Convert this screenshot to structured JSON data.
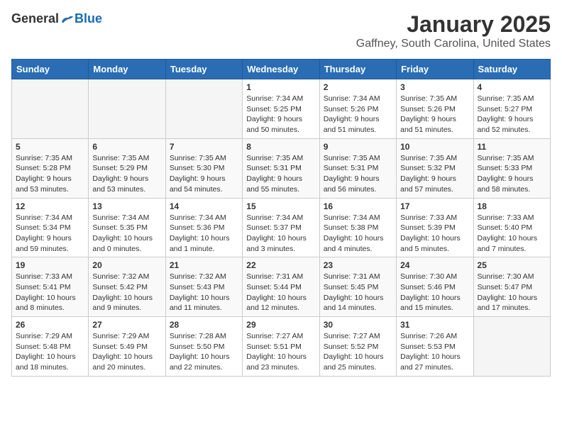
{
  "header": {
    "logo": {
      "general": "General",
      "blue": "Blue"
    },
    "title": "January 2025",
    "location": "Gaffney, South Carolina, United States"
  },
  "days_of_week": [
    "Sunday",
    "Monday",
    "Tuesday",
    "Wednesday",
    "Thursday",
    "Friday",
    "Saturday"
  ],
  "weeks": [
    {
      "cells": [
        {
          "day": null,
          "empty": true
        },
        {
          "day": null,
          "empty": true
        },
        {
          "day": null,
          "empty": true
        },
        {
          "day": "1",
          "sunrise": "7:34 AM",
          "sunset": "5:25 PM",
          "daylight": "9 hours and 50 minutes."
        },
        {
          "day": "2",
          "sunrise": "7:34 AM",
          "sunset": "5:26 PM",
          "daylight": "9 hours and 51 minutes."
        },
        {
          "day": "3",
          "sunrise": "7:35 AM",
          "sunset": "5:26 PM",
          "daylight": "9 hours and 51 minutes."
        },
        {
          "day": "4",
          "sunrise": "7:35 AM",
          "sunset": "5:27 PM",
          "daylight": "9 hours and 52 minutes."
        }
      ]
    },
    {
      "cells": [
        {
          "day": "5",
          "sunrise": "7:35 AM",
          "sunset": "5:28 PM",
          "daylight": "9 hours and 53 minutes."
        },
        {
          "day": "6",
          "sunrise": "7:35 AM",
          "sunset": "5:29 PM",
          "daylight": "9 hours and 53 minutes."
        },
        {
          "day": "7",
          "sunrise": "7:35 AM",
          "sunset": "5:30 PM",
          "daylight": "9 hours and 54 minutes."
        },
        {
          "day": "8",
          "sunrise": "7:35 AM",
          "sunset": "5:31 PM",
          "daylight": "9 hours and 55 minutes."
        },
        {
          "day": "9",
          "sunrise": "7:35 AM",
          "sunset": "5:31 PM",
          "daylight": "9 hours and 56 minutes."
        },
        {
          "day": "10",
          "sunrise": "7:35 AM",
          "sunset": "5:32 PM",
          "daylight": "9 hours and 57 minutes."
        },
        {
          "day": "11",
          "sunrise": "7:35 AM",
          "sunset": "5:33 PM",
          "daylight": "9 hours and 58 minutes."
        }
      ]
    },
    {
      "cells": [
        {
          "day": "12",
          "sunrise": "7:34 AM",
          "sunset": "5:34 PM",
          "daylight": "9 hours and 59 minutes."
        },
        {
          "day": "13",
          "sunrise": "7:34 AM",
          "sunset": "5:35 PM",
          "daylight": "10 hours and 0 minutes."
        },
        {
          "day": "14",
          "sunrise": "7:34 AM",
          "sunset": "5:36 PM",
          "daylight": "10 hours and 1 minute."
        },
        {
          "day": "15",
          "sunrise": "7:34 AM",
          "sunset": "5:37 PM",
          "daylight": "10 hours and 3 minutes."
        },
        {
          "day": "16",
          "sunrise": "7:34 AM",
          "sunset": "5:38 PM",
          "daylight": "10 hours and 4 minutes."
        },
        {
          "day": "17",
          "sunrise": "7:33 AM",
          "sunset": "5:39 PM",
          "daylight": "10 hours and 5 minutes."
        },
        {
          "day": "18",
          "sunrise": "7:33 AM",
          "sunset": "5:40 PM",
          "daylight": "10 hours and 7 minutes."
        }
      ]
    },
    {
      "cells": [
        {
          "day": "19",
          "sunrise": "7:33 AM",
          "sunset": "5:41 PM",
          "daylight": "10 hours and 8 minutes."
        },
        {
          "day": "20",
          "sunrise": "7:32 AM",
          "sunset": "5:42 PM",
          "daylight": "10 hours and 9 minutes."
        },
        {
          "day": "21",
          "sunrise": "7:32 AM",
          "sunset": "5:43 PM",
          "daylight": "10 hours and 11 minutes."
        },
        {
          "day": "22",
          "sunrise": "7:31 AM",
          "sunset": "5:44 PM",
          "daylight": "10 hours and 12 minutes."
        },
        {
          "day": "23",
          "sunrise": "7:31 AM",
          "sunset": "5:45 PM",
          "daylight": "10 hours and 14 minutes."
        },
        {
          "day": "24",
          "sunrise": "7:30 AM",
          "sunset": "5:46 PM",
          "daylight": "10 hours and 15 minutes."
        },
        {
          "day": "25",
          "sunrise": "7:30 AM",
          "sunset": "5:47 PM",
          "daylight": "10 hours and 17 minutes."
        }
      ]
    },
    {
      "cells": [
        {
          "day": "26",
          "sunrise": "7:29 AM",
          "sunset": "5:48 PM",
          "daylight": "10 hours and 18 minutes."
        },
        {
          "day": "27",
          "sunrise": "7:29 AM",
          "sunset": "5:49 PM",
          "daylight": "10 hours and 20 minutes."
        },
        {
          "day": "28",
          "sunrise": "7:28 AM",
          "sunset": "5:50 PM",
          "daylight": "10 hours and 22 minutes."
        },
        {
          "day": "29",
          "sunrise": "7:27 AM",
          "sunset": "5:51 PM",
          "daylight": "10 hours and 23 minutes."
        },
        {
          "day": "30",
          "sunrise": "7:27 AM",
          "sunset": "5:52 PM",
          "daylight": "10 hours and 25 minutes."
        },
        {
          "day": "31",
          "sunrise": "7:26 AM",
          "sunset": "5:53 PM",
          "daylight": "10 hours and 27 minutes."
        },
        {
          "day": null,
          "empty": true
        }
      ]
    }
  ],
  "labels": {
    "sunrise": "Sunrise:",
    "sunset": "Sunset:",
    "daylight": "Daylight:"
  }
}
